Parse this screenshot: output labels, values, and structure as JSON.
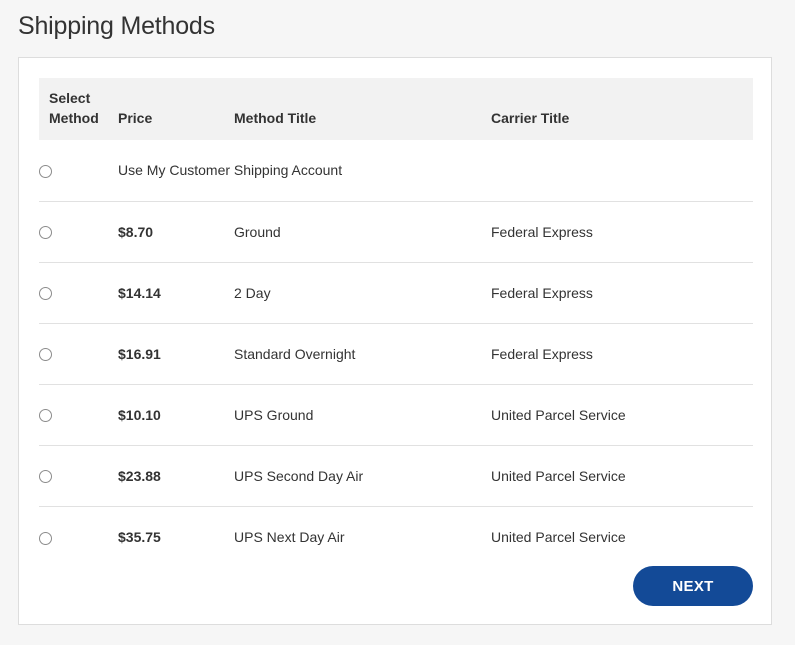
{
  "page": {
    "title": "Shipping Methods"
  },
  "table": {
    "headers": {
      "select_line1": "Select",
      "select_line2": "Method",
      "price": "Price",
      "method_title": "Method Title",
      "carrier_title": "Carrier Title"
    },
    "rows": [
      {
        "price": "",
        "method": "Use My Customer Shipping Account",
        "carrier": "",
        "selected": false
      },
      {
        "price": "$8.70",
        "method": "Ground",
        "carrier": "Federal Express",
        "selected": false
      },
      {
        "price": "$14.14",
        "method": "2 Day",
        "carrier": "Federal Express",
        "selected": false
      },
      {
        "price": "$16.91",
        "method": "Standard Overnight",
        "carrier": "Federal Express",
        "selected": false
      },
      {
        "price": "$10.10",
        "method": "UPS Ground",
        "carrier": "United Parcel Service",
        "selected": false
      },
      {
        "price": "$23.88",
        "method": "UPS Second Day Air",
        "carrier": "United Parcel Service",
        "selected": false
      },
      {
        "price": "$35.75",
        "method": "UPS Next Day Air",
        "carrier": "United Parcel Service",
        "selected": false
      }
    ]
  },
  "actions": {
    "next_label": "NEXT"
  },
  "colors": {
    "primary_button": "#134a97",
    "header_bg": "#f2f2f2",
    "row_divider": "#e1e1e1"
  }
}
